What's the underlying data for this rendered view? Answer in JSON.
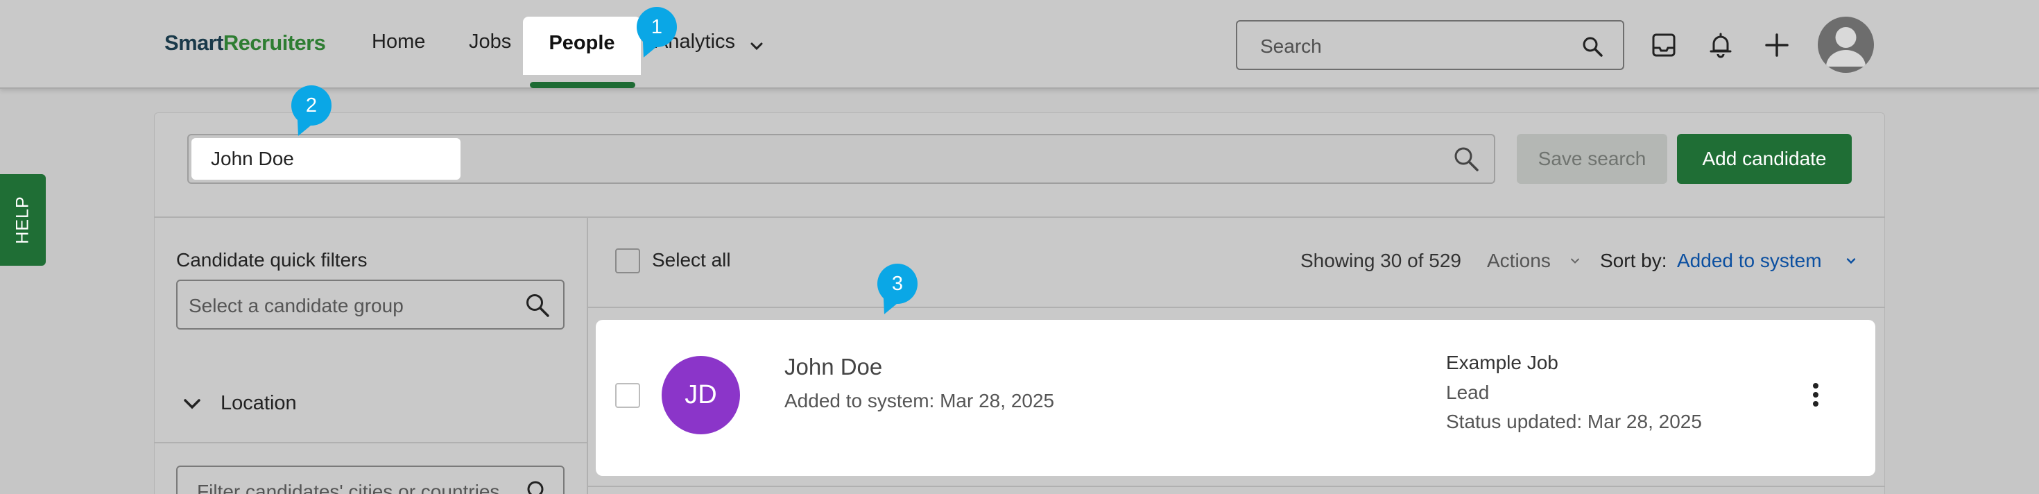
{
  "brand": {
    "part1": "Smart",
    "part2": "Recruiters"
  },
  "nav": {
    "home": "Home",
    "jobs": "Jobs",
    "people": "People",
    "analytics": "Analytics"
  },
  "header": {
    "search_placeholder": "Search",
    "icons": [
      "inbox-icon",
      "bell-icon",
      "plus-icon",
      "user-avatar-icon"
    ]
  },
  "help": {
    "label": "HELP"
  },
  "markers": [
    "1",
    "2",
    "3"
  ],
  "search": {
    "query": "John Doe",
    "save_label": "Save search",
    "add_label": "Add candidate"
  },
  "sidebar": {
    "quick_filters_label": "Candidate quick filters",
    "quick_filters_placeholder": "Select a candidate group",
    "location_label": "Location",
    "location_placeholder": "Filter candidates' cities or countries"
  },
  "results": {
    "select_all": "Select all",
    "showing": "Showing 30 of 529",
    "actions": "Actions",
    "sort_label": "Sort by:",
    "sort_value": "Added to system"
  },
  "candidate": {
    "initials": "JD",
    "name": "John Doe",
    "added": "Added to system: Mar 28, 2025",
    "job": "Example Job",
    "stage": "Lead",
    "status": "Status updated: Mar 28, 2025"
  },
  "colors": {
    "brand_green": "#1f6e35",
    "avatar_purple": "#8b35c9",
    "marker_blue": "#0aa7e6",
    "link_blue": "#0b4fa0"
  }
}
